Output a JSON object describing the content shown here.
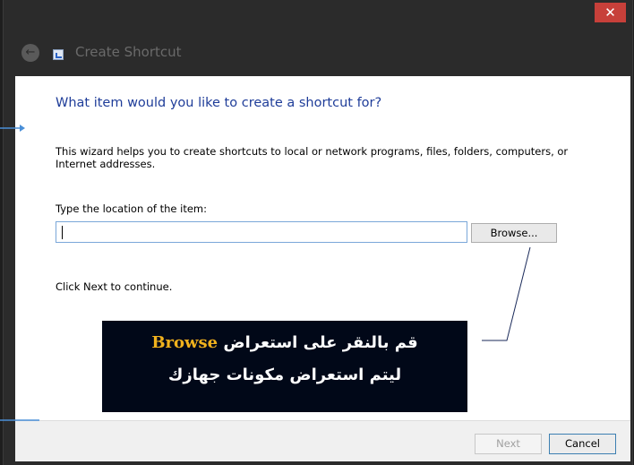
{
  "window": {
    "title": "Create Shortcut",
    "close_glyph": "✕",
    "back_glyph": "←"
  },
  "wizard": {
    "heading": "What item would you like to create a shortcut for?",
    "description": "This wizard helps you to create shortcuts to local or network programs, files, folders, computers, or Internet addresses.",
    "location_label": "Type the location of the item:",
    "location_value": "",
    "browse_label": "Browse...",
    "continue_hint": "Click Next to continue."
  },
  "footer": {
    "next_label": "Next",
    "cancel_label": "Cancel"
  },
  "annotation": {
    "line1_prefix": "قم بالنقر على استعراض",
    "keyword": "Browse",
    "line2": "ليتم استعراض مكونات جهازك",
    "keyword_color": "#f2b21d",
    "background_color": "#010818"
  },
  "colors": {
    "heading": "#1f3d99",
    "close_button": "#c7403a",
    "input_border": "#7aa7d9",
    "connector": "#4a8fd8"
  },
  "icons": [
    "close-icon",
    "back-arrow-icon",
    "shortcut-app-icon"
  ]
}
